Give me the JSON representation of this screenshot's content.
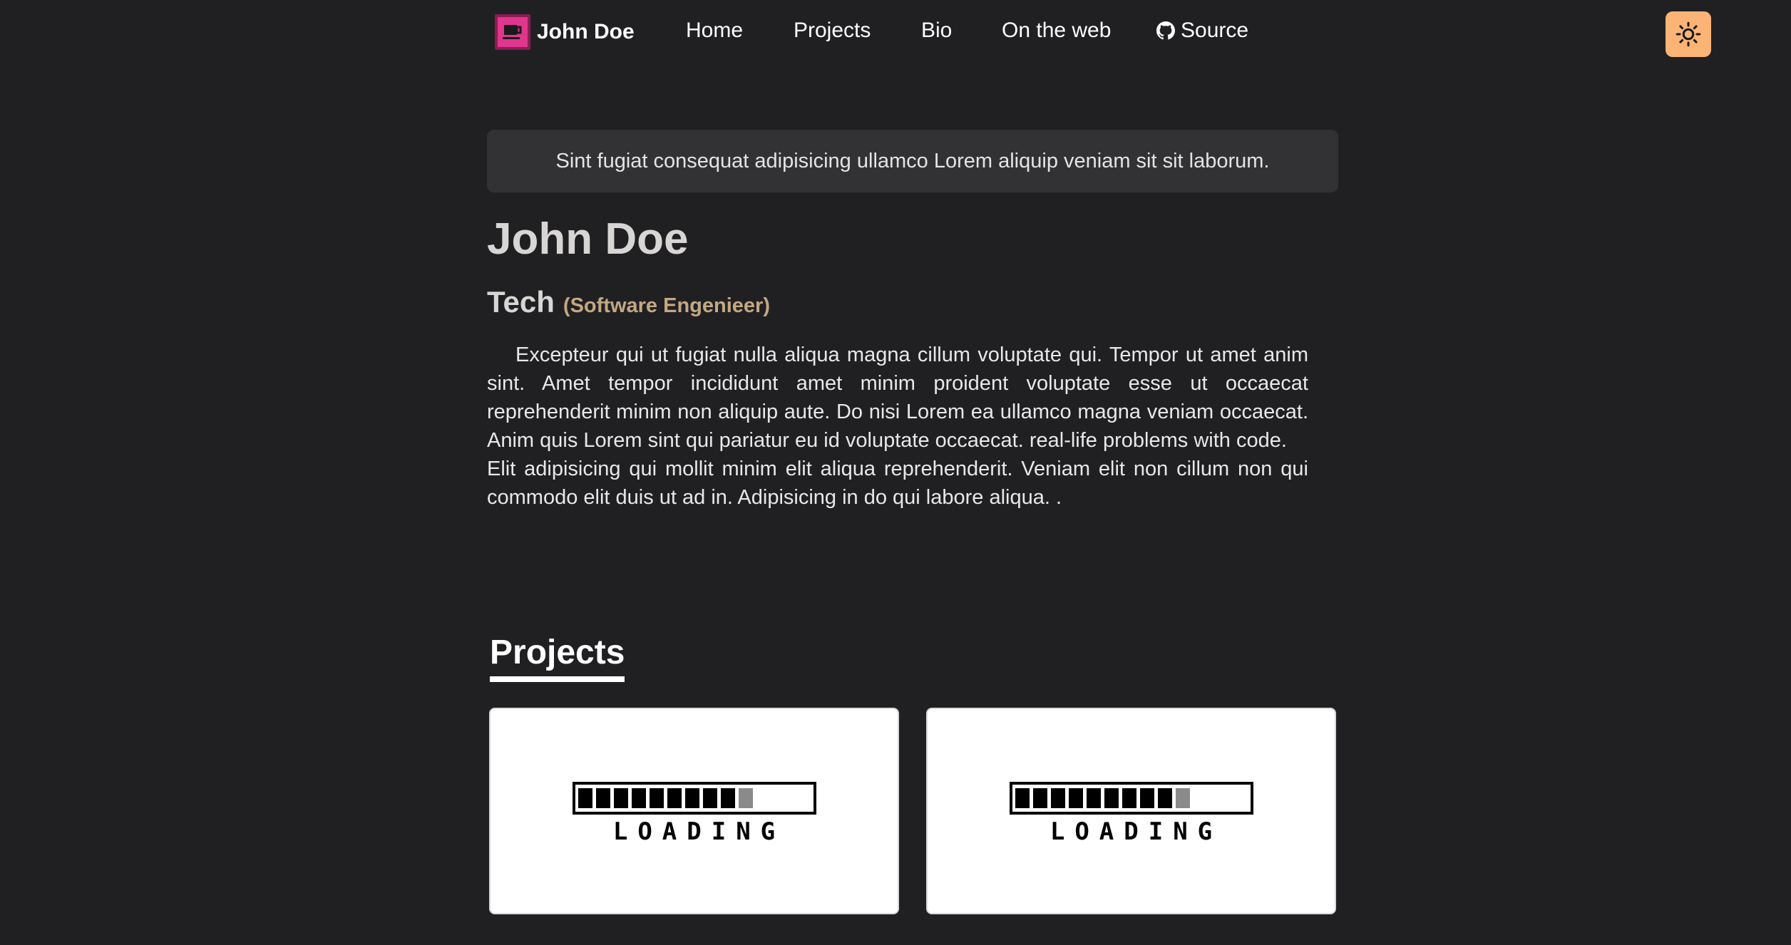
{
  "nav": {
    "brand": "John Doe",
    "links": [
      "Home",
      "Projects",
      "Bio",
      "On the web",
      "Source"
    ]
  },
  "announcement": "Sint fugiat consequat adipisicing ullamco Lorem aliquip veniam sit sit laborum.",
  "profile": {
    "name": "John Doe",
    "role": "Tech",
    "role_detail": "(Software Engenieer)",
    "bio_p1": "Excepteur qui ut fugiat nulla aliqua magna cillum voluptate qui. Tempor ut amet anim sint. Amet tempor incididunt amet minim proident voluptate esse ut occaecat reprehenderit minim non aliquip aute. Do nisi Lorem ea ullamco magna veniam occaecat. Anim quis Lorem sint qui pariatur eu id voluptate occaecat. real-life problems with code.",
    "bio_p2": "Elit adipisicing qui mollit minim elit aliqua reprehenderit. Veniam elit non cillum non qui commodo elit duis ut ad in. Adipisicing in do qui labore aliqua. ."
  },
  "projects": {
    "title": "Projects",
    "cards": [
      {
        "loading_label": "LOADING"
      },
      {
        "loading_label": "LOADING"
      }
    ]
  },
  "colors": {
    "background": "#202023",
    "accent": "#fbb475",
    "logo": "#e0368d",
    "role_detail": "#c4a882"
  },
  "icons": {
    "logo": "coffee-cup-icon",
    "source": "github-icon",
    "theme": "sun-icon"
  }
}
